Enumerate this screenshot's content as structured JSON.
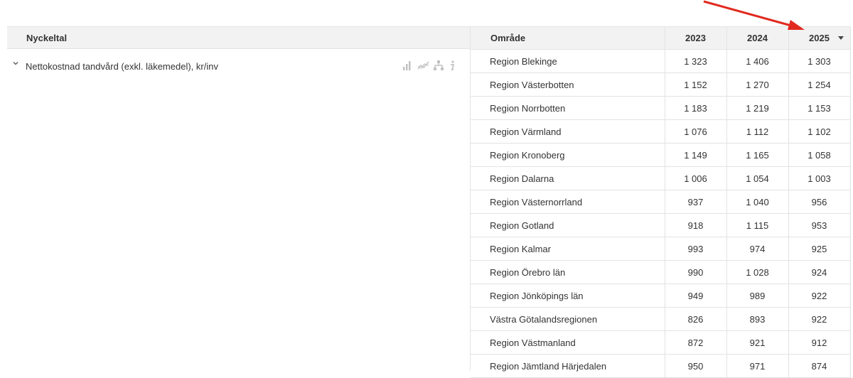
{
  "left_panel": {
    "header_title": "Nyckeltal",
    "kpi_label": "Nettokostnad tandvård (exkl. läkemedel), kr/inv",
    "icons": [
      "bar-chart-icon",
      "line-chart-icon",
      "hierarchy-icon",
      "info-icon"
    ]
  },
  "table": {
    "columns": [
      "Område",
      "2023",
      "2024",
      "2025"
    ],
    "sorted_column": "2025",
    "rows": [
      {
        "area": "Region Blekinge",
        "y2023": "1 323",
        "y2024": "1 406",
        "y2025": "1 303"
      },
      {
        "area": "Region Västerbotten",
        "y2023": "1 152",
        "y2024": "1 270",
        "y2025": "1 254"
      },
      {
        "area": "Region Norrbotten",
        "y2023": "1 183",
        "y2024": "1 219",
        "y2025": "1 153"
      },
      {
        "area": "Region Värmland",
        "y2023": "1 076",
        "y2024": "1 112",
        "y2025": "1 102"
      },
      {
        "area": "Region Kronoberg",
        "y2023": "1 149",
        "y2024": "1 165",
        "y2025": "1 058"
      },
      {
        "area": "Region Dalarna",
        "y2023": "1 006",
        "y2024": "1 054",
        "y2025": "1 003"
      },
      {
        "area": "Region Västernorrland",
        "y2023": "937",
        "y2024": "1 040",
        "y2025": "956"
      },
      {
        "area": "Region Gotland",
        "y2023": "918",
        "y2024": "1 115",
        "y2025": "953"
      },
      {
        "area": "Region Kalmar",
        "y2023": "993",
        "y2024": "974",
        "y2025": "925"
      },
      {
        "area": "Region Örebro län",
        "y2023": "990",
        "y2024": "1 028",
        "y2025": "924"
      },
      {
        "area": "Region Jönköpings län",
        "y2023": "949",
        "y2024": "989",
        "y2025": "922"
      },
      {
        "area": "Västra Götalandsregionen",
        "y2023": "826",
        "y2024": "893",
        "y2025": "922"
      },
      {
        "area": "Region Västmanland",
        "y2023": "872",
        "y2024": "921",
        "y2025": "912"
      },
      {
        "area": "Region Jämtland Härjedalen",
        "y2023": "950",
        "y2024": "971",
        "y2025": "874"
      }
    ]
  },
  "annotation": {
    "arrow_color": "#e02a20"
  }
}
